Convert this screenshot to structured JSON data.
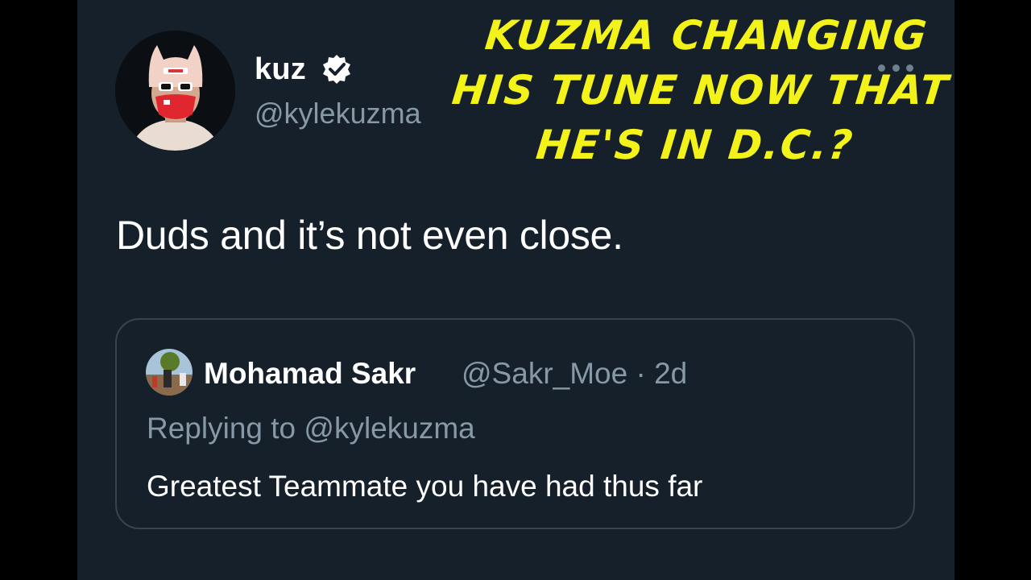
{
  "tweet": {
    "display_name": "kuz",
    "handle": "@kylekuzma",
    "text": "Duds and it’s not even close.",
    "verified_icon": "verified-badge-icon",
    "more_icon": "more-options-icon"
  },
  "quoted_tweet": {
    "display_name": "Mohamad Sakr",
    "meta": "@Sakr_Moe · 2d",
    "replying_to": "Replying to @kylekuzma",
    "text": "Greatest Teammate you have had thus far"
  },
  "overlay": {
    "lines": [
      "KUZMA CHANGING",
      "HIS TUNE NOW THAT",
      "HE'S IN D.C.?"
    ],
    "color": "#f3f319"
  },
  "colors": {
    "background": "#15202b",
    "primary_text": "#ffffff",
    "secondary_text": "#8899a6",
    "border": "#38444d"
  }
}
